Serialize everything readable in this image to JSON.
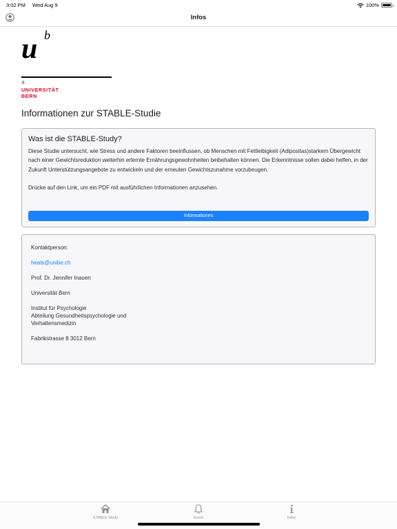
{
  "status_bar": {
    "time": "3:02 PM",
    "date": "Wed Aug 9",
    "battery": "100%",
    "battery_level": 1.0
  },
  "nav": {
    "title": "Infos",
    "profile_icon": "person-circle-icon"
  },
  "logo": {
    "u": "u",
    "b": "b",
    "small_b": "b",
    "line1": "UNIVERSITÄT",
    "line2": "BERN",
    "brand_red": "#e3001b"
  },
  "page_title": "Informationen zur STABLE-Studie",
  "info_card": {
    "title": "Was ist die STABLE-Study?",
    "text": "Diese Studie untersucht, wie Stress und andere Faktoren beeinflussen, ob Menschen mit Fettleibigkeit (Adipositas)starkem Übergewicht nach einer Gewichtsreduktion weiterhin erlernte Ernährungsgewohnheiten beibehalten können. Die Erkenntnisse sollen dabei helfen, in der Zukunft Unterstützungsangebote zu entwickeln und der erneuten Gewichtszunahme vorzubeugen.",
    "hint": "Drücke auf den Link, um ein PDF mit ausführlichen Informationen anzusehen.",
    "button_label": "Informationen"
  },
  "contact_card": {
    "label": "Kontaktperson:",
    "email": "heals@unibe.ch",
    "name": "Prof. Dr. Jennifer Inauen",
    "university": "Universität Bern",
    "institute_1": "Institut für Psychologie",
    "institute_2": "Abteilung Gesundheitspsychologie und",
    "institute_3": "Verhaltensmedizin",
    "address": "Fabrikstrasse 8 3012 Bern"
  },
  "tabs": [
    {
      "label": "STABLE Study",
      "icon": "house-icon"
    },
    {
      "label": "Event",
      "icon": "bell-icon"
    },
    {
      "label": "Infos",
      "icon": "info-icon"
    }
  ],
  "colors": {
    "accent": "#1a82fb",
    "card_bg": "#f7f7f9"
  }
}
